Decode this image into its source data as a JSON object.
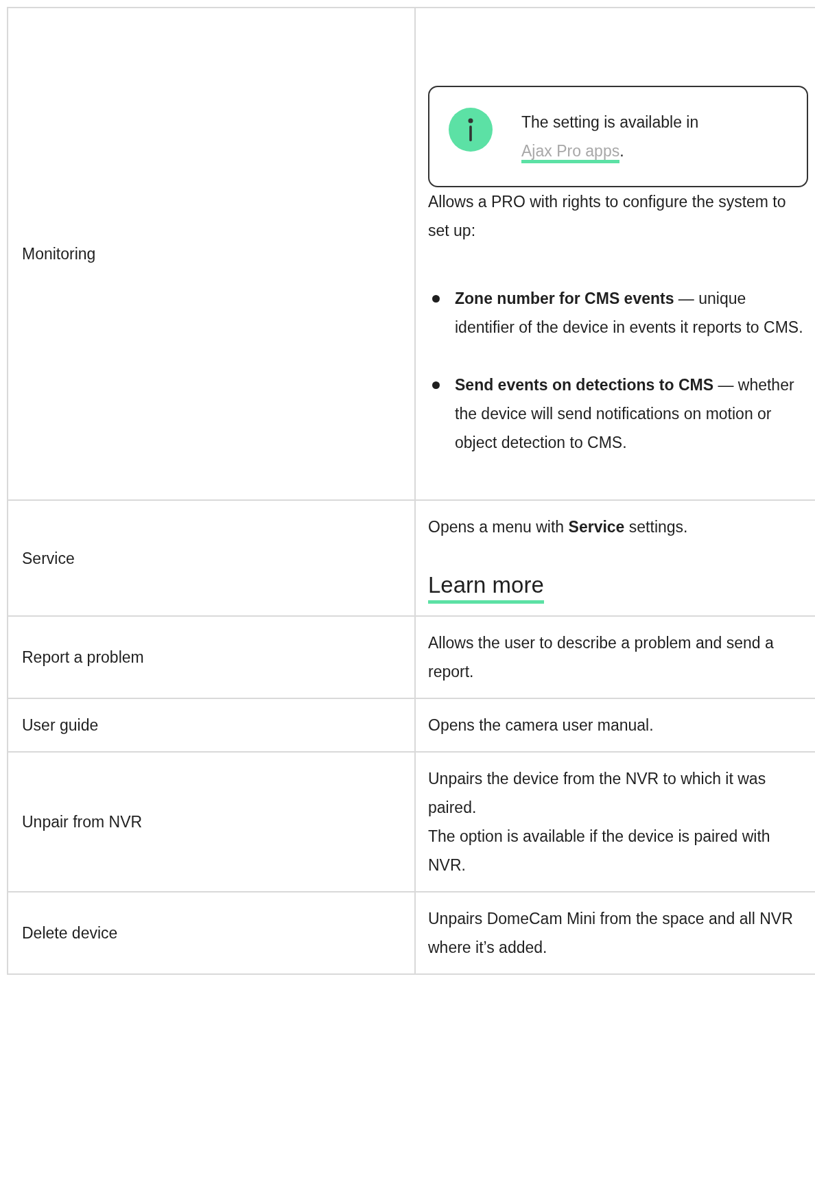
{
  "rows": [
    {
      "label": "Monitoring",
      "content": [
        {
          "kind": "note",
          "text": "The setting is available in",
          "link": "Ajax Pro apps",
          "suffix": "."
        },
        {
          "kind": "paragraph",
          "text": "Allows a PRO with rights to configure the system to set up:"
        },
        {
          "kind": "bullets",
          "items": [
            "**Zone number for CMS events** — unique identifier of the device in events it reports to CMS.",
            "**Send events on detections to CMS** — whether the device will send notifications on motion or object detection to CMS."
          ]
        }
      ]
    },
    {
      "label": "Service",
      "content": [
        {
          "kind": "paragraph",
          "text": "Opens a menu with **Service** settings."
        },
        {
          "kind": "link",
          "text": "Learn more"
        }
      ]
    },
    {
      "label": "Report a problem",
      "content": [
        {
          "kind": "paragraph",
          "text": "Allows the user to describe a problem and send a report."
        }
      ]
    },
    {
      "label": "User guide",
      "content": [
        {
          "kind": "paragraph",
          "text": "Opens the camera user manual."
        }
      ]
    },
    {
      "label": "Unpair from NVR",
      "content": [
        {
          "kind": "paragraph",
          "text": "Unpairs the device from the NVR to which it was paired."
        },
        {
          "kind": "paragraph",
          "text": "The option is available if the device is paired with NVR."
        }
      ]
    },
    {
      "label": "Delete device",
      "content": [
        {
          "kind": "paragraph",
          "text": "Unpairs DomeCam Mini from the space and all NVR where it’s added."
        }
      ]
    }
  ]
}
